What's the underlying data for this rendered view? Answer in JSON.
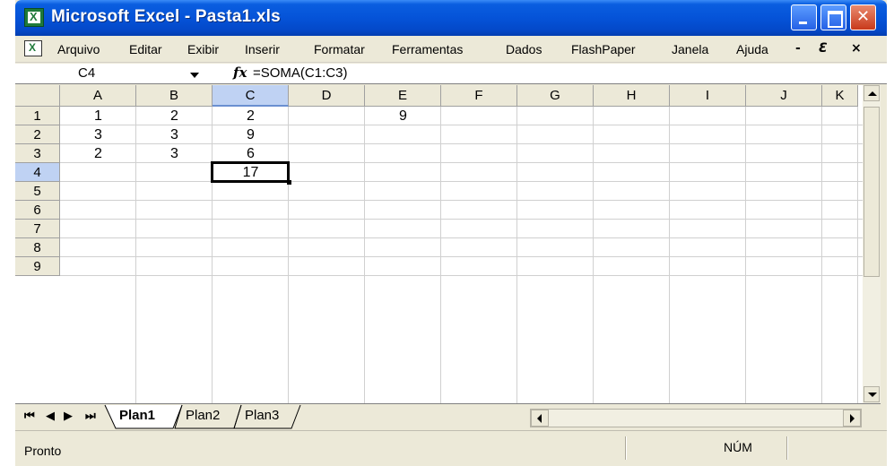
{
  "window": {
    "title": "Microsoft Excel - Pasta1.xls"
  },
  "menubar": {
    "items": [
      "Arquivo",
      "Editar",
      "Exibir",
      "Inserir",
      "Formatar",
      "Ferramentas",
      "Dados",
      "FlashPaper",
      "Janela",
      "Ajuda"
    ],
    "minimize_glyph": "-",
    "restore_glyph": "Ɛ",
    "close_glyph": "×"
  },
  "formula_bar": {
    "name_box": "C4",
    "fx_label": "fx",
    "formula": "=SOMA(C1:C3)"
  },
  "grid": {
    "columns": [
      "A",
      "B",
      "C",
      "D",
      "E",
      "F",
      "G",
      "H",
      "I",
      "J",
      "K"
    ],
    "rows": [
      "1",
      "2",
      "3",
      "4",
      "5",
      "6",
      "7",
      "8",
      "9"
    ],
    "cells": {
      "A1": "1",
      "B1": "2",
      "C1": "2",
      "E1": "9",
      "A2": "3",
      "B2": "3",
      "C2": "9",
      "A3": "2",
      "B3": "3",
      "C3": "6",
      "C4": "17"
    },
    "active_cell": "C4"
  },
  "sheet_tabs": {
    "nav": [
      "⏮",
      "◀",
      "▶",
      "⏭"
    ],
    "tabs": [
      "Plan1",
      "Plan2",
      "Plan3"
    ],
    "active": "Plan1"
  },
  "statusbar": {
    "status": "Pronto",
    "num": "NÚM"
  },
  "colors": {
    "titlebar": "#0553d8",
    "selected_header": "#bfd2f3",
    "chrome": "#ece9d8"
  }
}
